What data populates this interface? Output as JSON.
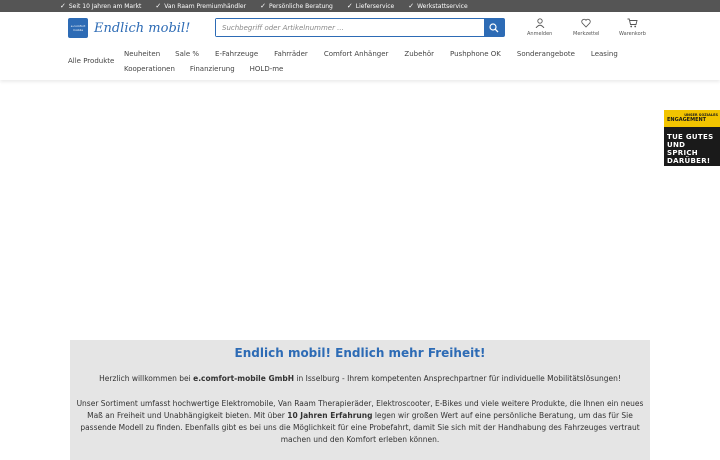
{
  "usps": [
    "Seit 10 Jahren am Markt",
    "Van Raam Premiumhändler",
    "Persönliche Beratung",
    "Lieferservice",
    "Werkstattservice"
  ],
  "logo": {
    "badge_line1": "e.comfort",
    "badge_line2": "mobile",
    "tagline": "Endlich mobil!"
  },
  "search": {
    "placeholder": "Suchbegriff oder Artikelnummer ..."
  },
  "actions": {
    "login": "Anmelden",
    "wishlist": "Merkzettel",
    "cart": "Warenkorb"
  },
  "nav": {
    "all_products": "Alle Produkte",
    "row1": [
      "Neuheiten",
      "Sale %",
      "E-Fahrzeuge",
      "Fahrräder",
      "Comfort Anhänger",
      "Zubehör",
      "Pushphone OK",
      "Sonderangebote",
      "Leasing"
    ],
    "row2": [
      "Kooperationen",
      "Finanzierung",
      "HOLD-me"
    ]
  },
  "promo": {
    "small": "UNSER SOZIALES",
    "title": "ENGAGEMENT",
    "line1": "TUE GUTES",
    "line2": "UND SPRICH",
    "line3": "DARÜBER!"
  },
  "welcome": {
    "heading": "Endlich mobil! Endlich mehr Freiheit!",
    "p1_pre": "Herzlich willkommen bei ",
    "p1_bold": "e.comfort-mobile GmbH",
    "p1_post": " in Isselburg - Ihrem kompetenten Ansprechpartner für individuelle Mobilitätslösungen!",
    "p2_pre": "Unser Sortiment umfasst hochwertige Elektromobile, Van Raam Therapieräder, Elektroscooter, E-Bikes und viele weitere Produkte, die Ihnen ein neues Maß an Freiheit und Unabhängigkeit bieten. Mit über ",
    "p2_bold": "10 Jahren Erfahrung",
    "p2_post": " legen wir großen Wert auf eine persönliche Beratung, um das für Sie passende Modell zu finden. Ebenfalls gibt es bei uns die Möglichkeit für eine Probefahrt, damit Sie sich mit der Handhabung des Fahrzeuges vertraut machen und den Komfort erleben können."
  },
  "colors": {
    "brand_blue": "#2d6bb5",
    "topbar": "#555555",
    "promo_yellow": "#f2c400",
    "content_bg": "#e5e5e5"
  }
}
